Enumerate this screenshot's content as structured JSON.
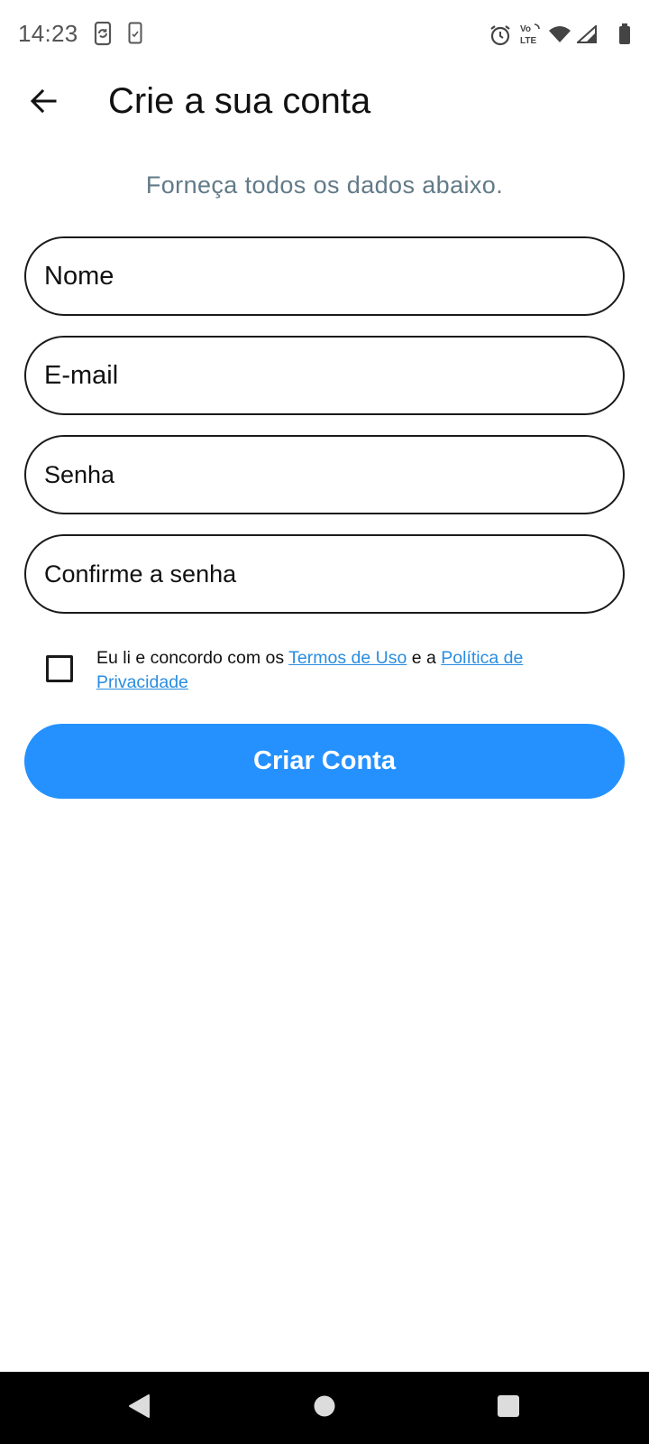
{
  "status_bar": {
    "time": "14:23",
    "left_icons": [
      "sync-phone-icon",
      "phone-checklist-icon"
    ],
    "right_icons": [
      "alarm-icon",
      "volte-icon",
      "wifi-icon",
      "signal-icon",
      "battery-icon"
    ],
    "volte_label_top": "Vo",
    "volte_label_bottom": "LTE"
  },
  "app_bar": {
    "back_icon": "arrow-left-icon",
    "title": "Crie a sua conta"
  },
  "subtitle": "Forneça todos os dados abaixo.",
  "form": {
    "name_placeholder": "Nome",
    "email_placeholder": "E-mail",
    "password_placeholder": "Senha",
    "confirm_password_placeholder": "Confirme a senha"
  },
  "terms": {
    "checked": false,
    "text_before": "Eu li e concordo com os ",
    "terms_link": "Termos de Uso",
    "text_middle": " e a ",
    "privacy_link": "Política de Privacidade"
  },
  "submit_label": "Criar Conta",
  "nav_bar": {
    "icons": [
      "back-triangle-icon",
      "home-circle-icon",
      "recents-square-icon"
    ]
  },
  "colors": {
    "accent": "#2491ff",
    "link": "#2a8ddf",
    "subtitle": "#627a88",
    "nav_background": "#000000"
  }
}
